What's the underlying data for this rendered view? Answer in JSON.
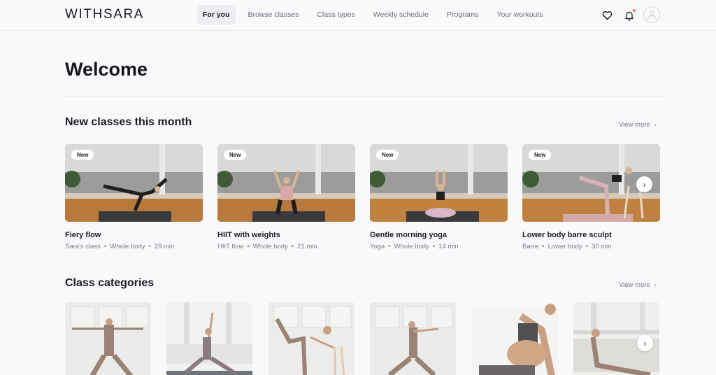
{
  "header": {
    "logo": "WITHSARA",
    "nav": [
      {
        "label": "For you",
        "active": true
      },
      {
        "label": "Browse classes",
        "active": false
      },
      {
        "label": "Class types",
        "active": false
      },
      {
        "label": "Weekly schedule",
        "active": false
      },
      {
        "label": "Programs",
        "active": false
      },
      {
        "label": "Your workouts",
        "active": false
      }
    ],
    "icons": [
      "heart-icon",
      "bell-icon",
      "user-avatar-icon"
    ],
    "notification_dot_color": "#e07a52"
  },
  "page": {
    "title": "Welcome"
  },
  "new_classes": {
    "title": "New classes this month",
    "view_more": "View more",
    "badge": "New",
    "items": [
      {
        "title": "Fiery flow",
        "meta": [
          "Sara's class",
          "Whole body",
          "29 min"
        ]
      },
      {
        "title": "HIIT with weights",
        "meta": [
          "HIIT flow",
          "Whole body",
          "21 min"
        ]
      },
      {
        "title": "Gentle morning yoga",
        "meta": [
          "Yoga",
          "Whole body",
          "14 min"
        ]
      },
      {
        "title": "Lower body barre sculpt",
        "meta": [
          "Barre",
          "Lower body",
          "30 min"
        ]
      }
    ],
    "separator": "•"
  },
  "class_categories": {
    "title": "Class categories",
    "view_more": "View more",
    "count_visible": 6
  }
}
